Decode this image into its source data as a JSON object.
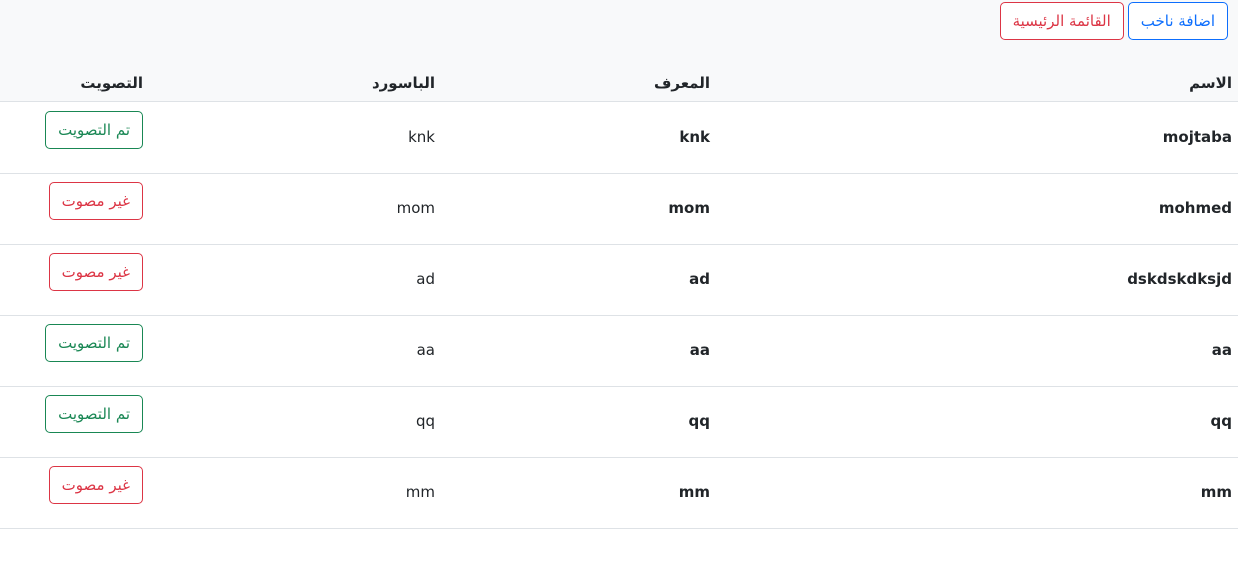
{
  "toolbar": {
    "add_voter_label": "اضافة ناخب",
    "main_menu_label": "القائمة الرئيسية"
  },
  "table": {
    "headers": {
      "name": "الاسم",
      "id": "المعرف",
      "password": "الباسورد",
      "vote": "التصويت"
    },
    "rows": [
      {
        "name": "mojtaba",
        "id": "knk",
        "password": "knk",
        "vote_label": "تم التصويت",
        "voted": true
      },
      {
        "name": "mohmed",
        "id": "mom",
        "password": "mom",
        "vote_label": "غير مصوت",
        "voted": false
      },
      {
        "name": "dskdskdksjd",
        "id": "ad",
        "password": "ad",
        "vote_label": "غير مصوت",
        "voted": false
      },
      {
        "name": "aa",
        "id": "aa",
        "password": "aa",
        "vote_label": "تم التصويت",
        "voted": true
      },
      {
        "name": "qq",
        "id": "qq",
        "password": "qq",
        "vote_label": "تم التصويت",
        "voted": true
      },
      {
        "name": "mm",
        "id": "mm",
        "password": "mm",
        "vote_label": "غير مصوت",
        "voted": false
      }
    ]
  },
  "colors": {
    "primary": "#0d6efd",
    "danger": "#dc3545",
    "success": "#198754",
    "border": "#dee2e6",
    "header_bg": "#f8f9fa"
  }
}
